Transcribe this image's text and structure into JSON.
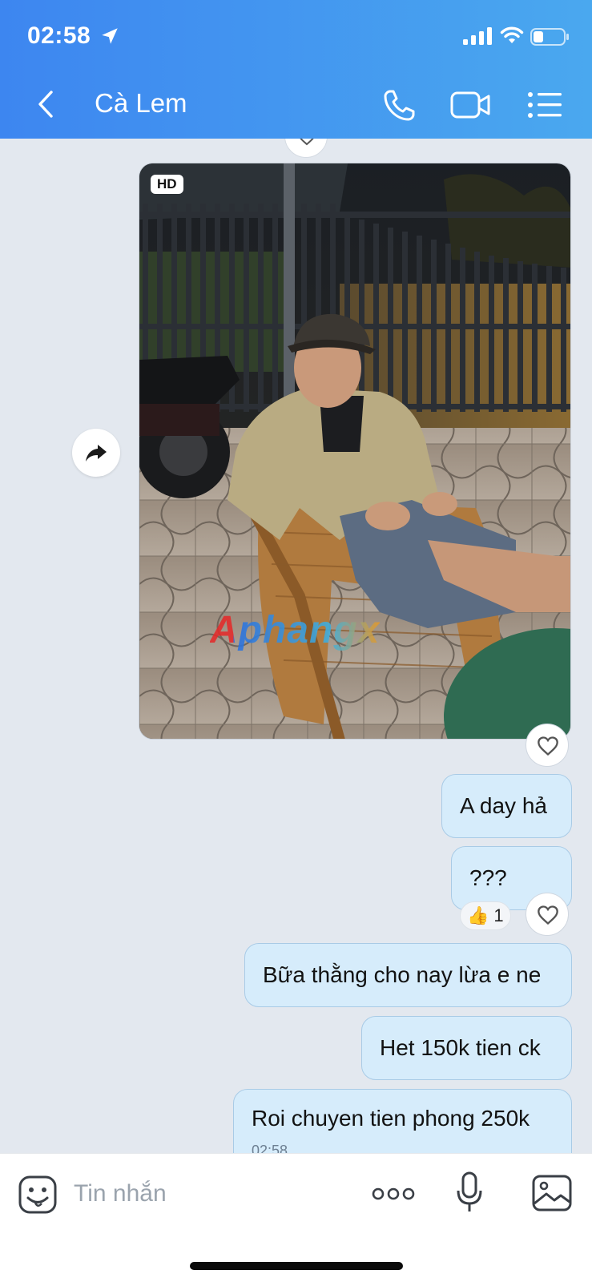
{
  "status_bar": {
    "time": "02:58",
    "icons": [
      "location-arrow-icon",
      "signal-icon",
      "wifi-icon",
      "battery-icon"
    ]
  },
  "header": {
    "contact_name": "Cà Lem",
    "icons": [
      "back-icon",
      "phone-call-icon",
      "video-call-icon",
      "menu-list-icon"
    ]
  },
  "messages": {
    "photo": {
      "badge": "HD",
      "watermark": "Aphangx"
    },
    "texts": [
      "A day hả",
      "???",
      "Bữa thằng cho nay lừa e ne",
      "Het 150k tien ck",
      "Roi chuyen tien phong 250k"
    ],
    "reaction": {
      "emoji": "👍",
      "count": "1"
    },
    "last_time": "02:58"
  },
  "composer": {
    "placeholder": "Tin nhắn",
    "icons": [
      "sticker-icon",
      "more-options-icon",
      "microphone-icon",
      "image-icon"
    ]
  },
  "colors": {
    "header_start": "#3d86f0",
    "header_end": "#4aa8ef",
    "chat_background": "#e3e8ef",
    "sent_bubble": "#d6ecfb"
  }
}
